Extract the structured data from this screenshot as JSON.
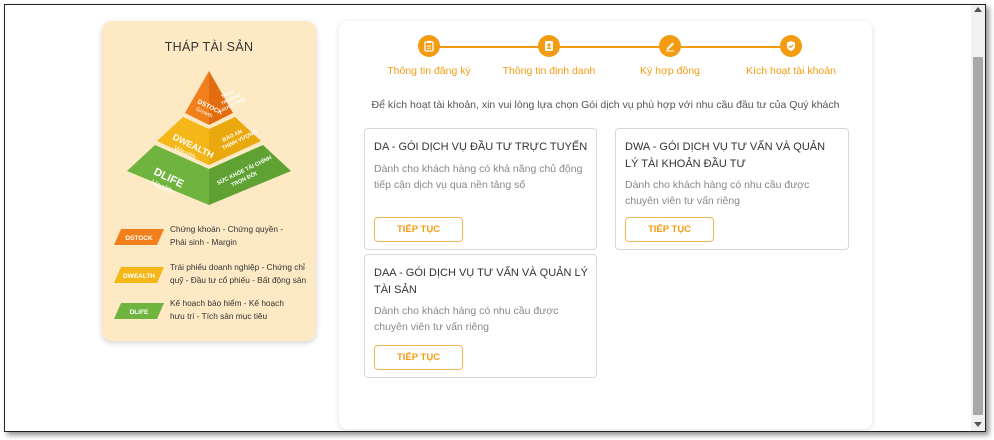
{
  "pyramid": {
    "title": "THÁP TÀI SẢN",
    "tiers": [
      {
        "brand": "DSTOCK",
        "sub": "Growth",
        "side": "TĂNG TRƯỞNG VƯỢT TRỘI",
        "side_lines": [
          "TĂNG",
          "TRƯỞNG",
          "VƯỢT TRỘI"
        ],
        "color": "#f07f1c"
      },
      {
        "brand": "DWEALTH",
        "sub": "Wealth",
        "side": "BẢO AN THỊNH VƯỢNG",
        "side_lines": [
          "BẢO AN",
          "THỊNH VƯỢNG"
        ],
        "color": "#f5b617"
      },
      {
        "brand": "DLIFE",
        "sub": "Health",
        "side": "SỨC KHỎE TÀI CHÍNH TRỌN ĐỜI",
        "side_lines": [
          "SỨC KHỎE TÀI CHÍNH",
          "TRỌN ĐỜI"
        ],
        "color": "#6fb43f"
      }
    ],
    "legend": [
      {
        "tag": "DSTOCK",
        "color": "#f07f1c",
        "lines": [
          "Chứng khoán - Chứng quyền -",
          "Phái sinh - Margin"
        ]
      },
      {
        "tag": "DWEALTH",
        "color": "#f5b617",
        "lines": [
          "Trái phiếu doanh nghiệp - Chứng chỉ",
          "quỹ - Đầu tư cổ phiếu - Bất động sản"
        ]
      },
      {
        "tag": "DLIFE",
        "color": "#6fb43f",
        "lines": [
          "Kế hoạch bảo hiểm - Kế hoạch",
          "hưu trí - Tích sản mục tiêu"
        ]
      }
    ]
  },
  "stepper": {
    "steps": [
      {
        "label": "Thông tin đăng ký",
        "icon": "clipboard-icon"
      },
      {
        "label": "Thông tin định danh",
        "icon": "id-card-icon"
      },
      {
        "label": "Ký hợp đồng",
        "icon": "pen-icon"
      },
      {
        "label": "Kích hoạt tài khoản",
        "icon": "shield-check-icon"
      }
    ]
  },
  "intro": "Để kích hoạt tài khoản, xin vui lòng lựa chọn Gói dịch vụ phù hợp với nhu cầu đầu tư của Quý khách",
  "packages": [
    {
      "title": "DA - GÓI DỊCH VỤ ĐẦU TƯ TRỰC TUYẾN",
      "desc": "Dành cho khách hàng có khả năng chủ động tiếp cận dịch vụ qua nền tảng số",
      "button": "TIẾP TỤC"
    },
    {
      "title": "DWA - GÓI DỊCH VỤ TƯ VẤN VÀ QUẢN LÝ TÀI KHOẢN ĐẦU TƯ",
      "desc": "Dành cho khách hàng có nhu cầu được chuyên viên tư vấn riêng",
      "button": "TIẾP TỤC"
    },
    {
      "title": "DAA - GÓI DỊCH VỤ TƯ VẤN VÀ QUẢN LÝ TÀI SẢN",
      "desc": "Dành cho khách hàng có nhu cầu được chuyên viên tư vấn riêng",
      "button": "TIẾP TỤC"
    }
  ],
  "colors": {
    "accent": "#f39c12",
    "panel_bg": "#fde9c4"
  }
}
